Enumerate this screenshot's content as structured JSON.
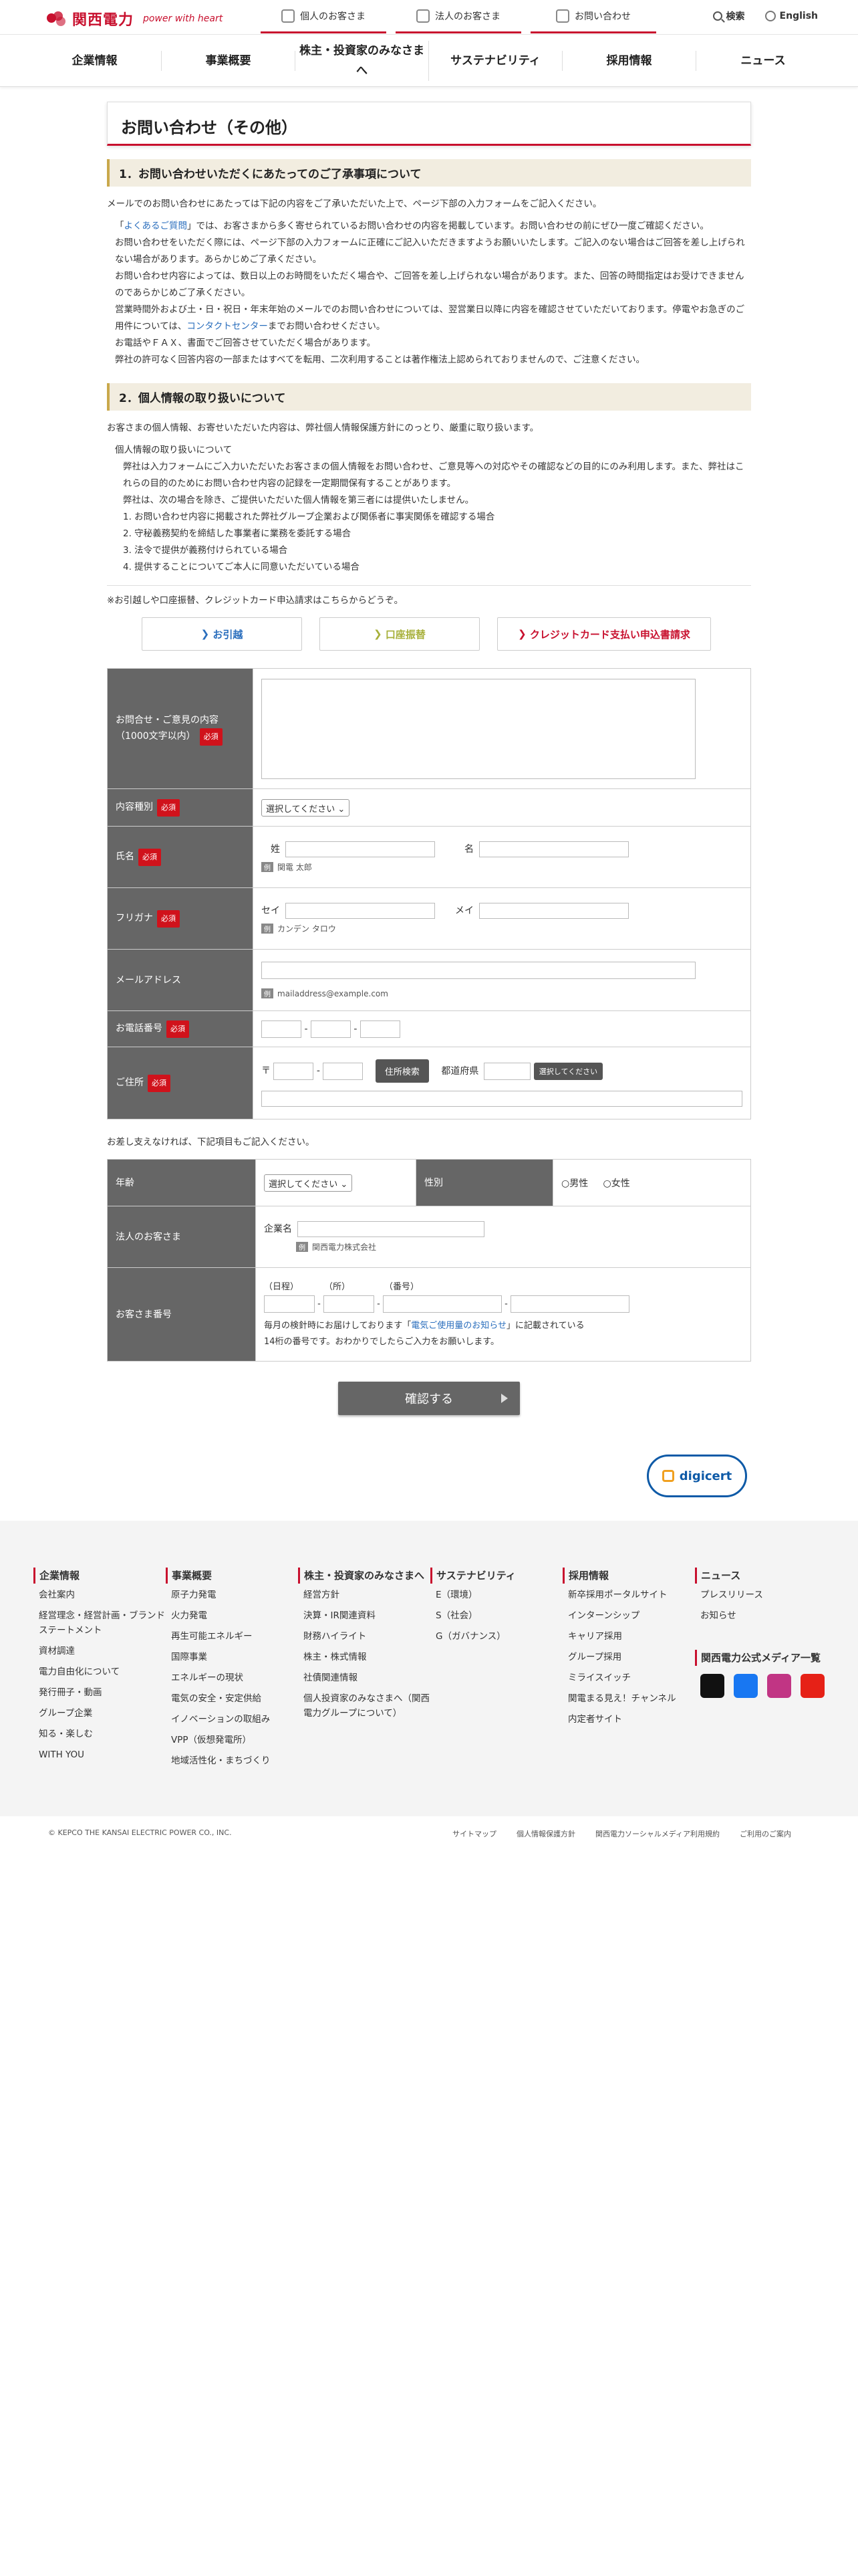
{
  "header": {
    "logo_text": "関西電力",
    "logo_tag": "power with heart",
    "tabs": [
      "個人のお客さま",
      "法人のお客さま",
      "お問い合わせ"
    ],
    "search": "検索",
    "lang": "English"
  },
  "nav": [
    "企業情報",
    "事業概要",
    "株主・投資家のみなさまへ",
    "サステナビリティ",
    "採用情報",
    "ニュース"
  ],
  "page_title": "お問い合わせ（その他）",
  "sec1": {
    "head": "1．お問い合わせいただくにあたってのご了承事項について",
    "intro": "メールでのお問い合わせにあたっては下記の内容をご了承いただいた上で、ページ下部の入力フォームをご記入ください。",
    "l1a": "「",
    "l1link": "よくあるご質問",
    "l1b": "」では、お客さまから多く寄せられているお問い合わせの内容を掲載しています。お問い合わせの前にぜひ一度ご確認ください。",
    "l2": "お問い合わせをいただく際には、ページ下部の入力フォームに正確にご記入いただきますようお願いいたします。ご記入のない場合はご回答を差し上げられない場合があります。あらかじめご了承ください。",
    "l3": "お問い合わせ内容によっては、数日以上のお時間をいただく場合や、ご回答を差し上げられない場合があります。また、回答の時間指定はお受けできませんのであらかじめご了承ください。",
    "l4": "営業時間外および土・日・祝日・年末年始のメールでのお問い合わせについては、翌営業日以降に内容を確認させていただいております。停電やお急ぎのご用件については、",
    "l4link": "コンタクトセンター",
    "l4b": "までお問い合わせください。",
    "l5": "お電話やＦＡＸ、書面でご回答させていただく場合があります。",
    "l6": "弊社の許可なく回答内容の一部またはすべてを転用、二次利用することは著作権法上認められておりませんので、ご注意ください。"
  },
  "sec2": {
    "head": "2．個人情報の取り扱いについて",
    "intro": "お客さまの個人情報、お寄せいただいた内容は、弊社個人情報保護方針にのっとり、厳重に取り扱います。",
    "sub": "個人情報の取り扱いについて",
    "b1": "弊社は入力フォームにご入力いただいたお客さまの個人情報をお問い合わせ、ご意見等への対応やその確認などの目的にのみ利用します。また、弊社はこれらの目的のためにお問い合わせ内容の記録を一定期間保有することがあります。",
    "b2": "弊社は、次の場合を除き、ご提供いただいた個人情報を第三者には提供いたしません。",
    "o1": "1. お問い合わせ内容に掲載された弊社グループ企業および関係者に事実関係を確認する場合",
    "o2": "2. 守秘義務契約を締結した事業者に業務を委託する場合",
    "o3": "3. 法令で提供が義務付けられている場合",
    "o4": "4. 提供することについてご本人に同意いただいている場合"
  },
  "move_note": "※お引越しや口座振替、クレジットカード申込請求はこちらからどうぞ。",
  "quick_buttons": [
    "お引越",
    "口座振替",
    "クレジットカード支払い申込書請求"
  ],
  "form": {
    "req": "必須",
    "q_label": "お問合せ・ご意見の内容",
    "q_sub": "（1000文字以内）",
    "kind_label": "内容種別",
    "select_default": "選択してください",
    "name_label": "氏名",
    "sei": "姓",
    "mei": "名",
    "eg": "例",
    "name_eg": "関電 太郎",
    "kana_label": "フリガナ",
    "kana_sei": "セイ",
    "kana_mei": "メイ",
    "kana_eg": "カンデン タロウ",
    "mail_label": "メールアドレス",
    "mail_eg": "mailaddress@example.com",
    "tel_label": "お電話番号",
    "addr_label": "ご住所",
    "zip": "〒",
    "addr_btn": "住所検索",
    "pref": "都道府県",
    "pref_sel": "選択してください",
    "opt_note": "お差し支えなければ、下記項目もご記入ください。",
    "age_label": "年齢",
    "sex_label": "性別",
    "male": "男性",
    "female": "女性",
    "corp_label": "法人のお客さま",
    "corp_name": "企業名",
    "corp_eg": "関西電力株式会社",
    "cust_label": "お客さま番号",
    "c1": "（日程）",
    "c2": "（所）",
    "c3": "（番号）",
    "cust_note1": "毎月の検針時にお届けしております「",
    "cust_link": "電気ご使用量のお知らせ",
    "cust_note2": "」に記載されている",
    "cust_note3": "14桁の番号です。おわかりでしたらご入力をお願いします。",
    "submit": "確認する"
  },
  "digicert": "digicert",
  "footer": {
    "cols": [
      {
        "h": "企業情報",
        "items": [
          "会社案内",
          "経営理念・経営計画・ブランドステートメント",
          "資材調達",
          "電力自由化について",
          "発行冊子・動画",
          "グループ企業",
          "知る・楽しむ",
          "WITH YOU"
        ]
      },
      {
        "h": "事業概要",
        "items": [
          "原子力発電",
          "火力発電",
          "再生可能エネルギー",
          "国際事業",
          "エネルギーの現状",
          "電気の安全・安定供給",
          "イノベーションの取組み",
          "VPP（仮想発電所）",
          "地域活性化・まちづくり"
        ]
      },
      {
        "h": "株主・投資家のみなさまへ",
        "items": [
          "経営方針",
          "決算・IR関連資料",
          "財務ハイライト",
          "株主・株式情報",
          "社債関連情報",
          "個人投資家のみなさまへ（関西電力グループについて）"
        ]
      },
      {
        "h": "サステナビリティ",
        "items": [
          "E（環境）",
          "S（社会）",
          "G（ガバナンス）"
        ]
      },
      {
        "h": "採用情報",
        "items": [
          "新卒採用ポータルサイト",
          "インターンシップ",
          "キャリア採用",
          "グループ採用",
          "ミライスイッチ",
          "関電まる見え！チャンネル",
          "内定者サイト"
        ]
      },
      {
        "h": "ニュース",
        "items": [
          "プレスリリース",
          "お知らせ"
        ]
      }
    ],
    "media": "関西電力公式メディア一覧",
    "copy": "© KEPCO THE KANSAI ELECTRIC POWER CO., INC.",
    "links": [
      "サイトマップ",
      "個人情報保護方針",
      "関西電力ソーシャルメディア利用規約",
      "ご利用のご案内"
    ]
  }
}
